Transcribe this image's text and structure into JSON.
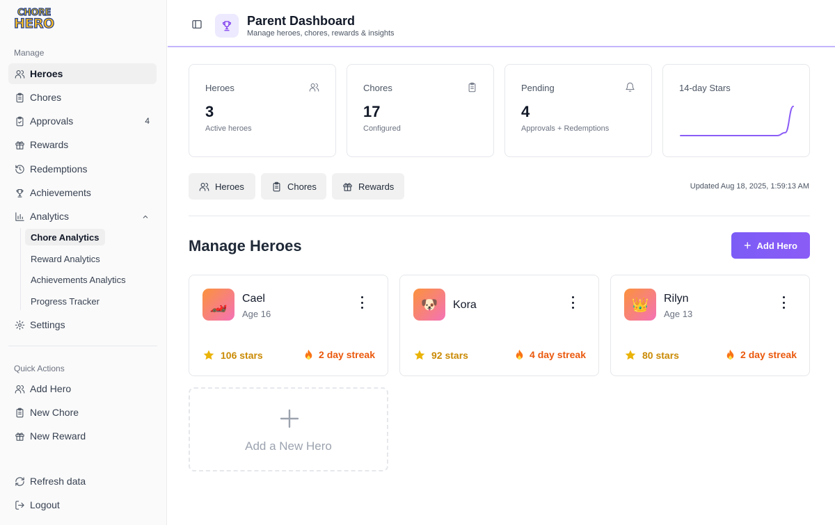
{
  "brand": {
    "line1": "CHORE",
    "line2": "HERO"
  },
  "sidebar": {
    "manage_title": "Manage",
    "items": [
      {
        "label": "Heroes",
        "icon": "users-icon"
      },
      {
        "label": "Chores",
        "icon": "clipboard-icon"
      },
      {
        "label": "Approvals",
        "icon": "clipboard-check-icon",
        "badge": "4"
      },
      {
        "label": "Rewards",
        "icon": "gift-icon"
      },
      {
        "label": "Redemptions",
        "icon": "history-icon"
      },
      {
        "label": "Achievements",
        "icon": "trophy-icon"
      },
      {
        "label": "Analytics",
        "icon": "bar-chart-icon"
      }
    ],
    "analytics_sub": [
      {
        "label": "Chore Analytics"
      },
      {
        "label": "Reward Analytics"
      },
      {
        "label": "Achievements Analytics"
      },
      {
        "label": "Progress Tracker"
      }
    ],
    "settings_label": "Settings",
    "quick_title": "Quick Actions",
    "quick": [
      {
        "label": "Add Hero"
      },
      {
        "label": "New Chore"
      },
      {
        "label": "New Reward"
      }
    ],
    "refresh_label": "Refresh data",
    "logout_label": "Logout"
  },
  "header": {
    "title": "Parent Dashboard",
    "subtitle": "Manage heroes, chores, rewards & insights"
  },
  "stats": [
    {
      "label": "Heroes",
      "value": "3",
      "note": "Active heroes"
    },
    {
      "label": "Chores",
      "value": "17",
      "note": "Configured"
    },
    {
      "label": "Pending",
      "value": "4",
      "note": "Approvals + Redemptions"
    },
    {
      "label": "14-day Stars"
    }
  ],
  "sparkline": {
    "values": [
      0,
      0,
      0,
      0,
      0,
      0,
      0,
      0,
      0,
      0,
      0,
      0,
      0,
      10,
      100
    ],
    "color": "#8b5cf6"
  },
  "pills": [
    {
      "label": "Heroes"
    },
    {
      "label": "Chores"
    },
    {
      "label": "Rewards"
    }
  ],
  "updated": "Updated Aug 18, 2025, 1:59:13 AM",
  "section": {
    "title": "Manage Heroes",
    "add_button": "Add Hero"
  },
  "heroes": [
    {
      "name": "Cael",
      "age": "Age 16",
      "avatar": "🏎️",
      "stars": "106 stars",
      "streak": "2 day streak"
    },
    {
      "name": "Kora",
      "age": "",
      "avatar": "🐶",
      "stars": "92 stars",
      "streak": "4 day streak"
    },
    {
      "name": "Rilyn",
      "age": "Age 13",
      "avatar": "👑",
      "stars": "80 stars",
      "streak": "2 day streak"
    }
  ],
  "add_card_label": "Add a New Hero",
  "colors": {
    "accent": "#8b5cf6",
    "star": "#ca8a04",
    "streak": "#ea580c"
  }
}
